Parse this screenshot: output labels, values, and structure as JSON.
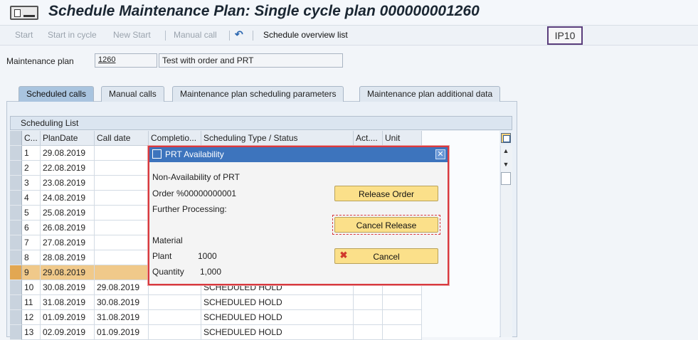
{
  "title": "Schedule Maintenance Plan: Single cycle plan 000000001260",
  "toolbar": {
    "start": "Start",
    "start_in_cycle": "Start in cycle",
    "new_start": "New Start",
    "manual_call": "Manual call",
    "schedule_overview": "Schedule overview list",
    "badge": "IP10"
  },
  "plan": {
    "label": "Maintenance plan",
    "number": "1260",
    "description": "Test with order and PRT"
  },
  "tabs": [
    {
      "label": "Scheduled calls"
    },
    {
      "label": "Manual calls"
    },
    {
      "label": "Maintenance plan scheduling parameters"
    },
    {
      "label": "Maintenance plan additional data"
    }
  ],
  "list": {
    "title": "Scheduling List",
    "columns": [
      "C...",
      "PlanDate",
      "Call date",
      "Completio...",
      "Scheduling Type / Status",
      "Act....",
      "Unit"
    ],
    "rows": [
      {
        "c": "1",
        "plan": "29.08.2019",
        "call": "",
        "comp": "",
        "status": ""
      },
      {
        "c": "2",
        "plan": "22.08.2019",
        "call": "",
        "comp": "",
        "status": ""
      },
      {
        "c": "3",
        "plan": "23.08.2019",
        "call": "",
        "comp": "",
        "status": ""
      },
      {
        "c": "4",
        "plan": "24.08.2019",
        "call": "",
        "comp": "",
        "status": ""
      },
      {
        "c": "5",
        "plan": "25.08.2019",
        "call": "",
        "comp": "",
        "status": ""
      },
      {
        "c": "6",
        "plan": "26.08.2019",
        "call": "",
        "comp": "",
        "status": ""
      },
      {
        "c": "7",
        "plan": "27.08.2019",
        "call": "",
        "comp": "",
        "status": ""
      },
      {
        "c": "8",
        "plan": "28.08.2019",
        "call": "",
        "comp": "",
        "status": ""
      },
      {
        "c": "9",
        "plan": "29.08.2019",
        "call": "",
        "comp": "",
        "status": ""
      },
      {
        "c": "10",
        "plan": "30.08.2019",
        "call": "29.08.2019",
        "comp": "",
        "status": "SCHEDULED  HOLD"
      },
      {
        "c": "11",
        "plan": "31.08.2019",
        "call": "30.08.2019",
        "comp": "",
        "status": "SCHEDULED  HOLD"
      },
      {
        "c": "12",
        "plan": "01.09.2019",
        "call": "31.08.2019",
        "comp": "",
        "status": "SCHEDULED  HOLD"
      },
      {
        "c": "13",
        "plan": "02.09.2019",
        "call": "01.09.2019",
        "comp": "",
        "status": "SCHEDULED  HOLD"
      }
    ],
    "highlighted_row": 9
  },
  "dialog": {
    "title": "PRT Availability",
    "line1": "Non-Availability of PRT",
    "line2": "Order %00000000001",
    "line3": "Further Processing:",
    "material_label": "Material",
    "plant_label": "Plant",
    "plant_value": "1000",
    "quantity_label": "Quantity",
    "quantity_value": "1,000",
    "btn_release": "Release Order",
    "btn_cancel_release": "Cancel Release",
    "btn_cancel": "Cancel"
  },
  "colors": {
    "dialog_border": "#d9393e",
    "dialog_title_bg": "#3d74bd",
    "button_bg": "#fbe08a",
    "highlight_row": "#f0c98a",
    "tab_selected": "#a9c4df"
  }
}
